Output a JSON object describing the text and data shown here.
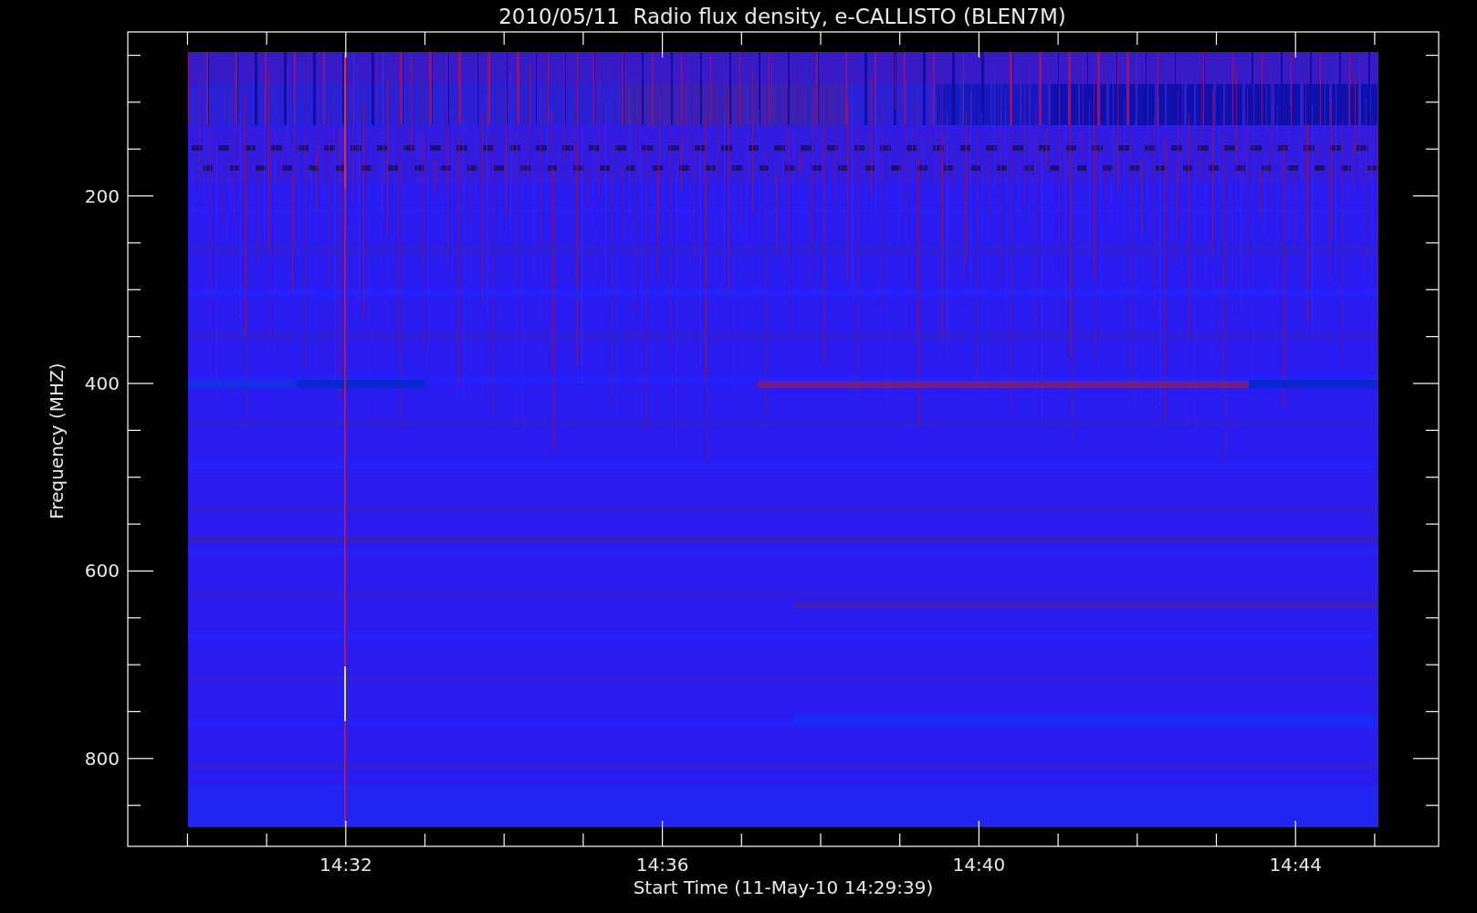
{
  "title": "2010/05/11  Radio flux density, e-CALLISTO (BLEN7M)",
  "y_axis": {
    "label": "Frequency (MHZ)",
    "ticks": [
      "200",
      "400",
      "600",
      "800"
    ]
  },
  "x_axis": {
    "label": "Start Time (11-May-10 14:29:39)",
    "ticks": [
      "14:32",
      "14:36",
      "14:40",
      "14:44"
    ]
  }
}
